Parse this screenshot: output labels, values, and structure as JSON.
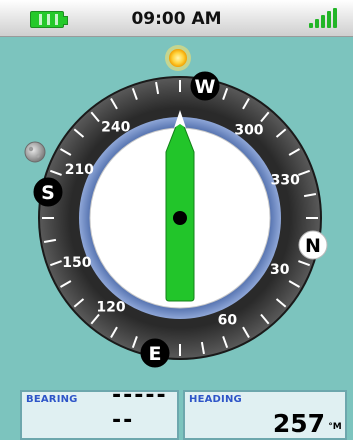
{
  "status_bar": {
    "time": "09:00 AM"
  },
  "compass": {
    "dial_numbers": [
      "240",
      "300",
      "330",
      "30",
      "60",
      "120",
      "150",
      "210"
    ],
    "cardinals": [
      "W",
      "N",
      "E",
      "S"
    ],
    "colors": {
      "needle": "#22c52a",
      "bezel": "#3a3a3a",
      "face": "#ffffff",
      "inner_ring": "#3f5ea8"
    }
  },
  "bearing": {
    "label": "BEARING",
    "value": "-------"
  },
  "heading": {
    "label": "HEADING",
    "value": "257",
    "unit": "°M"
  }
}
